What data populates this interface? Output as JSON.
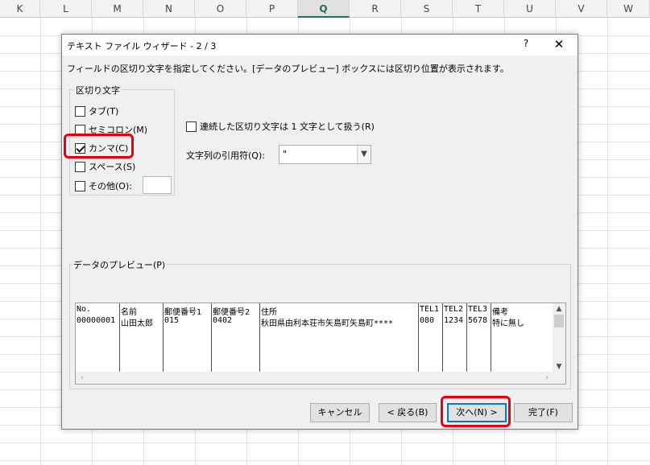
{
  "sheet": {
    "columns": [
      "K",
      "L",
      "M",
      "N",
      "O",
      "P",
      "Q",
      "R",
      "S",
      "T",
      "U",
      "V",
      "W"
    ],
    "selected_column": "Q"
  },
  "dialog": {
    "title": "テキスト ファイル ウィザード - 2 / 3",
    "help_label": "?",
    "close_label": "✕",
    "instruction": "フィールドの区切り文字を指定してください。[データのプレビュー] ボックスには区切り位置が表示されます。",
    "delimiters": {
      "legend": "区切り文字",
      "tab": {
        "label": "タブ(T)",
        "checked": false
      },
      "semicolon": {
        "label": "セミコロン(M)",
        "checked": false
      },
      "comma": {
        "label": "カンマ(C)",
        "checked": true
      },
      "space": {
        "label": "スペース(S)",
        "checked": false
      },
      "other": {
        "label": "その他(O):",
        "checked": false,
        "value": ""
      }
    },
    "consecutive": {
      "label": "連続した区切り文字は 1 文字として扱う(R)",
      "checked": false
    },
    "text_qualifier": {
      "label": "文字列の引用符(Q):",
      "value": "\""
    },
    "preview": {
      "legend": "データのプレビュー(P)",
      "headers": [
        "No.",
        "名前",
        "郵便番号1",
        "郵便番号2",
        "住所",
        "TEL1",
        "TEL2",
        "TEL3",
        "備考"
      ],
      "rows": [
        [
          "00000001",
          "山田太郎",
          "015",
          "0402",
          "秋田県由利本荘市矢島町矢島町****",
          "080",
          "1234",
          "5678",
          "特に無し"
        ]
      ]
    },
    "buttons": {
      "cancel": "キャンセル",
      "back": "< 戻る(B)",
      "next": "次へ(N) >",
      "finish": "完了(F)"
    }
  },
  "colors": {
    "highlight": "#e60012",
    "excel_green": "#217346",
    "focus_blue": "#0078d7"
  }
}
